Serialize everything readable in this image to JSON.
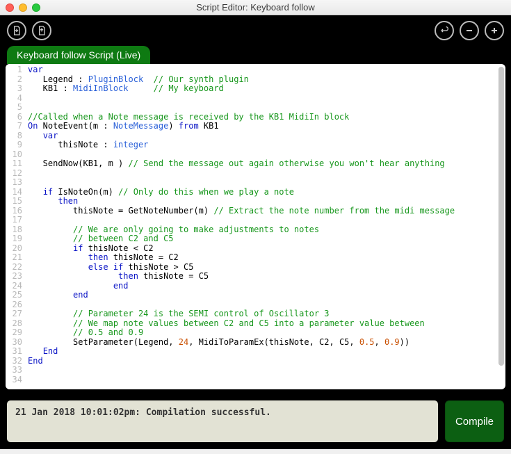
{
  "window": {
    "title": "Script Editor:  Keyboard follow"
  },
  "tab": {
    "label": "Keyboard follow Script (Live)"
  },
  "status": {
    "message": "21 Jan 2018 10:01:02pm: Compilation successful."
  },
  "compile": {
    "label": "Compile"
  },
  "code": {
    "line_count": 34,
    "tokens": [
      [
        {
          "t": "var",
          "c": "kw"
        }
      ],
      [
        {
          "t": "   Legend : ",
          "c": ""
        },
        {
          "t": "PluginBlock",
          "c": "type"
        },
        {
          "t": "  ",
          "c": ""
        },
        {
          "t": "// Our synth plugin",
          "c": "cm"
        }
      ],
      [
        {
          "t": "   KB1 : ",
          "c": ""
        },
        {
          "t": "MidiInBlock",
          "c": "type"
        },
        {
          "t": "     ",
          "c": ""
        },
        {
          "t": "// My keyboard",
          "c": "cm"
        }
      ],
      [],
      [],
      [
        {
          "t": "//Called when a Note message is received by the KB1 MidiIn block",
          "c": "cm"
        }
      ],
      [
        {
          "t": "On",
          "c": "kw"
        },
        {
          "t": " NoteEvent(m : ",
          "c": ""
        },
        {
          "t": "NoteMessage",
          "c": "type"
        },
        {
          "t": ") ",
          "c": ""
        },
        {
          "t": "from",
          "c": "kw"
        },
        {
          "t": " KB1",
          "c": ""
        }
      ],
      [
        {
          "t": "   ",
          "c": ""
        },
        {
          "t": "var",
          "c": "kw"
        }
      ],
      [
        {
          "t": "      thisNote : ",
          "c": ""
        },
        {
          "t": "integer",
          "c": "type"
        }
      ],
      [],
      [
        {
          "t": "   SendNow(KB1, m ) ",
          "c": ""
        },
        {
          "t": "// Send the message out again otherwise you won't hear anything",
          "c": "cm"
        }
      ],
      [],
      [],
      [
        {
          "t": "   ",
          "c": ""
        },
        {
          "t": "if",
          "c": "kw"
        },
        {
          "t": " IsNoteOn(m) ",
          "c": ""
        },
        {
          "t": "// Only do this when we play a note",
          "c": "cm"
        }
      ],
      [
        {
          "t": "      ",
          "c": ""
        },
        {
          "t": "then",
          "c": "kw"
        }
      ],
      [
        {
          "t": "         thisNote = GetNoteNumber(m) ",
          "c": ""
        },
        {
          "t": "// Extract the note number from the midi message",
          "c": "cm"
        }
      ],
      [],
      [
        {
          "t": "         ",
          "c": ""
        },
        {
          "t": "// We are only going to make adjustments to notes",
          "c": "cm"
        }
      ],
      [
        {
          "t": "         ",
          "c": ""
        },
        {
          "t": "// between C2 and C5",
          "c": "cm"
        }
      ],
      [
        {
          "t": "         ",
          "c": ""
        },
        {
          "t": "if",
          "c": "kw"
        },
        {
          "t": " thisNote < C2",
          "c": ""
        }
      ],
      [
        {
          "t": "            ",
          "c": ""
        },
        {
          "t": "then",
          "c": "kw"
        },
        {
          "t": " thisNote = C2",
          "c": ""
        }
      ],
      [
        {
          "t": "            ",
          "c": ""
        },
        {
          "t": "else",
          "c": "kw"
        },
        {
          "t": " ",
          "c": ""
        },
        {
          "t": "if",
          "c": "kw"
        },
        {
          "t": " thisNote > C5",
          "c": ""
        }
      ],
      [
        {
          "t": "                  ",
          "c": ""
        },
        {
          "t": "then",
          "c": "kw"
        },
        {
          "t": " thisNote = C5",
          "c": ""
        }
      ],
      [
        {
          "t": "                 ",
          "c": ""
        },
        {
          "t": "end",
          "c": "kw"
        }
      ],
      [
        {
          "t": "         ",
          "c": ""
        },
        {
          "t": "end",
          "c": "kw"
        }
      ],
      [],
      [
        {
          "t": "         ",
          "c": ""
        },
        {
          "t": "// Parameter 24 is the SEMI control of Oscillator 3",
          "c": "cm"
        }
      ],
      [
        {
          "t": "         ",
          "c": ""
        },
        {
          "t": "// We map note values between C2 and C5 into a parameter value between",
          "c": "cm"
        }
      ],
      [
        {
          "t": "         ",
          "c": ""
        },
        {
          "t": "// 0.5 and 0.9",
          "c": "cm"
        }
      ],
      [
        {
          "t": "         SetParameter(Legend, ",
          "c": ""
        },
        {
          "t": "24",
          "c": "num"
        },
        {
          "t": ", MidiToParamEx(thisNote, C2, C5, ",
          "c": ""
        },
        {
          "t": "0.5",
          "c": "num"
        },
        {
          "t": ", ",
          "c": ""
        },
        {
          "t": "0.9",
          "c": "num"
        },
        {
          "t": "))",
          "c": ""
        }
      ],
      [
        {
          "t": "   ",
          "c": ""
        },
        {
          "t": "End",
          "c": "kw"
        }
      ],
      [
        {
          "t": "End",
          "c": "kw"
        }
      ],
      [],
      []
    ]
  }
}
